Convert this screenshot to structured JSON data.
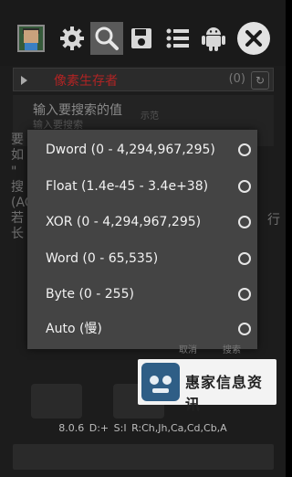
{
  "toolbar": {
    "icons": [
      "app-logo-icon",
      "gear-icon",
      "search-icon",
      "save-icon",
      "list-icon",
      "android-icon",
      "close-icon"
    ]
  },
  "process": {
    "name": "像素生存者",
    "count": "(0)"
  },
  "background": {
    "dialog_title": "输入要搜索的值",
    "dialog_sub": "输入要搜索",
    "dialog_sub2": "示范",
    "lines": [
      "要",
      "如",
      "\"",
      "搜",
      "(AC",
      "若",
      "长"
    ],
    "right_char": "行"
  },
  "dialog": {
    "options": [
      {
        "label": "Dword (0 - 4,294,967,295)"
      },
      {
        "label": "Float (1.4e-45 - 3.4e+38)"
      },
      {
        "label": "XOR (0 - 4,294,967,295)"
      },
      {
        "label": "Word (0 - 65,535)"
      },
      {
        "label": "Byte (0 - 255)"
      },
      {
        "label": "Auto (慢)"
      }
    ],
    "buttons": [
      "取消",
      "搜索"
    ]
  },
  "footer": {
    "status": "8.0.6  D:+  S:I    R:Ch,Jh,Ca,Cd,Cb,A"
  },
  "watermark": {
    "text": "惠家信息资讯"
  },
  "colors": {
    "process_name": "#b02424",
    "dialog_bg": "#444444",
    "radio": "#e6e6e6",
    "watermark_logo": "#2f5e86"
  }
}
